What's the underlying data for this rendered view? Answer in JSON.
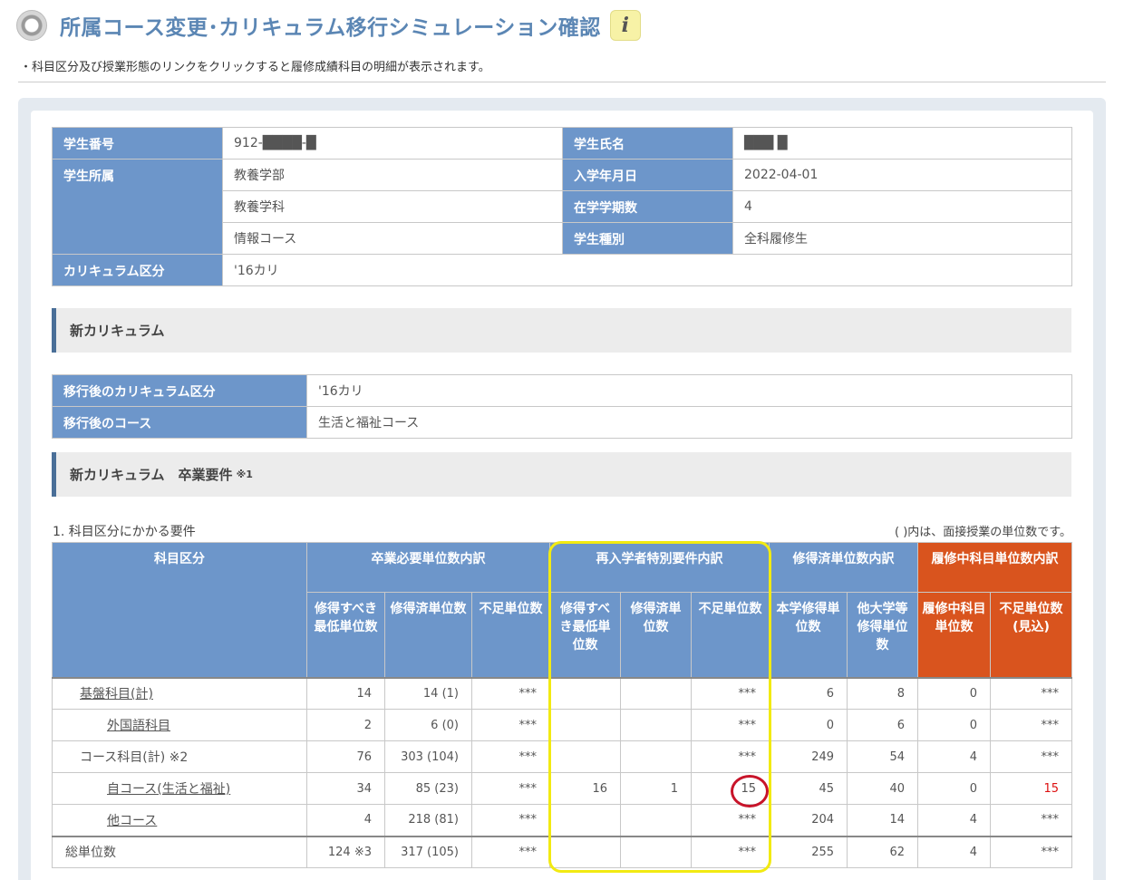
{
  "header": {
    "title": "所属コース変更･カリキュラム移行シミュレーション確認",
    "info_glyph": "i"
  },
  "notice": "・科目区分及び授業形態のリンクをクリックすると履修成績科目の明細が表示されます。",
  "student": {
    "id_label": "学生番号",
    "id_value": "912-████-█",
    "name_label": "学生氏名",
    "name_value": "███ █",
    "affil_label": "学生所属",
    "faculty": "教養学部",
    "department": "教養学科",
    "course": "情報コース",
    "entry_label": "入学年月日",
    "entry_value": "2022-04-01",
    "terms_label": "在学学期数",
    "terms_value": "4",
    "type_label": "学生種別",
    "type_value": "全科履修生",
    "curr_label": "カリキュラム区分",
    "curr_value": "'16カリ"
  },
  "new_curriculum": {
    "section_title": "新カリキュラム",
    "curr_label": "移行後のカリキュラム区分",
    "curr_value": "'16カリ",
    "course_label": "移行後のコース",
    "course_value": "生活と福祉コース"
  },
  "grad_req": {
    "section_title": "新カリキュラム　卒業要件",
    "section_note": "※1",
    "caption": "1. 科目区分にかかる要件",
    "note": "( )内は、面接授業の単位数です。",
    "headers": {
      "category": "科目区分",
      "group_required": "卒業必要単位数内訳",
      "group_reentry": "再入学者特別要件内訳",
      "group_earned": "修得済単位数内訳",
      "group_enrolled": "履修中科目単位数内訳",
      "min_required": "修得すべき最低単位数",
      "earned": "修得済単位数",
      "shortage": "不足単位数",
      "re_min_required": "修得すべき最低単位数",
      "re_earned": "修得済単位数",
      "re_shortage": "不足単位数",
      "own_univ": "本学修得単位数",
      "other_univ": "他大学等修得単位数",
      "enrolled": "履修中科目単位数",
      "shortage_est": "不足単位数(見込)"
    },
    "rows": [
      {
        "name": "基盤科目(計)",
        "min": "14",
        "earned": "14 (1)",
        "short": "***",
        "re_min": "",
        "re_earned": "",
        "re_short": "***",
        "own": "6",
        "other": "8",
        "enrolled": "0",
        "short_est": "***"
      },
      {
        "name": "外国語科目",
        "min": "2",
        "earned": "6 (0)",
        "short": "***",
        "re_min": "",
        "re_earned": "",
        "re_short": "***",
        "own": "0",
        "other": "6",
        "enrolled": "0",
        "short_est": "***"
      },
      {
        "name": "コース科目(計) ※2",
        "min": "76",
        "earned": "303 (104)",
        "short": "***",
        "re_min": "",
        "re_earned": "",
        "re_short": "***",
        "own": "249",
        "other": "54",
        "enrolled": "4",
        "short_est": "***"
      },
      {
        "name": "自コース(生活と福祉)",
        "min": "34",
        "earned": "85 (23)",
        "short": "***",
        "re_min": "16",
        "re_earned": "1",
        "re_short": "15",
        "own": "45",
        "other": "40",
        "enrolled": "0",
        "short_est": "15"
      },
      {
        "name": "他コース",
        "min": "4",
        "earned": "218 (81)",
        "short": "***",
        "re_min": "",
        "re_earned": "",
        "re_short": "***",
        "own": "204",
        "other": "14",
        "enrolled": "4",
        "short_est": "***"
      },
      {
        "name": "総単位数",
        "min": "124 ※3",
        "earned": "317 (105)",
        "short": "***",
        "re_min": "",
        "re_earned": "",
        "re_short": "***",
        "own": "255",
        "other": "62",
        "enrolled": "4",
        "short_est": "***"
      }
    ]
  },
  "colors": {
    "header_blue": "#6d96ca",
    "header_orange": "#d9541e",
    "title_blue": "#5b86b4",
    "highlight_yellow": "#f2ea12",
    "highlight_red": "#c8142a"
  }
}
